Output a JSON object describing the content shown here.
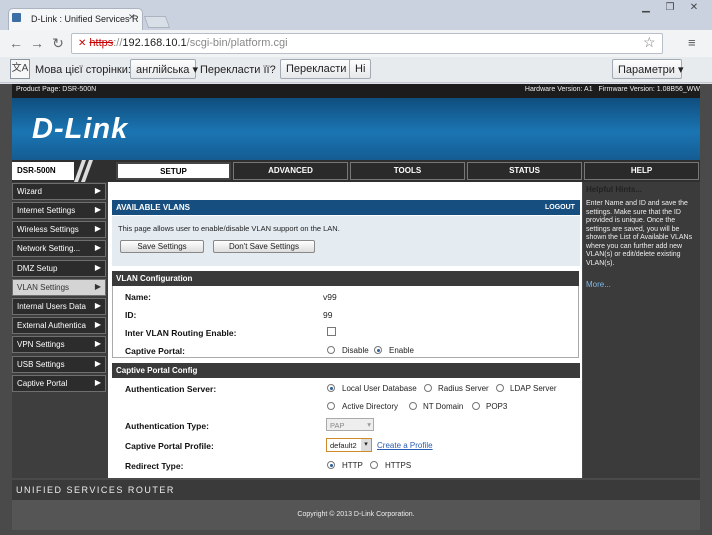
{
  "browser": {
    "tab_title": "D-Link : Unified Services R",
    "url_scheme": "https",
    "url_sep": "://",
    "url_host": "192.168.10.1",
    "url_path": "/scgi-bin/platform.cgi"
  },
  "translate_bar": {
    "prompt": "Мова цієї сторінки:",
    "language": "англійська",
    "question": "Перекласти її?",
    "translate_button": "Перекласти",
    "no_button": "Ні",
    "options_button": "Параметри"
  },
  "page": {
    "product_page": "Product Page: DSR-500N",
    "hardware_version": "Hardware Version: A1",
    "firmware_version": "Firmware Version: 1.08B56_WW",
    "logo": "D-Link",
    "model": "DSR-500N",
    "nav_tabs": [
      "SETUP",
      "ADVANCED",
      "TOOLS",
      "STATUS",
      "HELP"
    ],
    "sidebar": [
      "Wizard",
      "Internet Settings",
      "Wireless Settings",
      "Network Setting...",
      "DMZ Setup",
      "VLAN Settings",
      "Internal Users Data",
      "External Authentica",
      "VPN Settings",
      "USB Settings",
      "Captive Portal"
    ],
    "available_vlans": {
      "title": "AVAILABLE VLANS",
      "logout": "LOGOUT",
      "description": "This page allows user to enable/disable VLAN support on the LAN.",
      "save_button": "Save Settings",
      "dont_save_button": "Don't Save Settings"
    },
    "vlan_config": {
      "title": "VLAN Configuration",
      "name_label": "Name:",
      "name_value": "v99",
      "id_label": "ID:",
      "id_value": "99",
      "inter_vlan_label": "Inter VLAN Routing Enable:",
      "captive_portal_label": "Captive Portal:",
      "disable": "Disable",
      "enable": "Enable"
    },
    "captive_config": {
      "title": "Captive Portal Config",
      "auth_server_label": "Authentication Server:",
      "servers": [
        "Local User Database",
        "Radius Server",
        "LDAP Server",
        "Active Directory",
        "NT Domain",
        "POP3"
      ],
      "auth_type_label": "Authentication Type:",
      "auth_type_value": "PAP",
      "profile_label": "Captive Portal Profile:",
      "profile_value": "default2",
      "create_profile": "Create a Profile",
      "redirect_label": "Redirect Type:",
      "redirect_http": "HTTP",
      "redirect_https": "HTTPS"
    },
    "help": {
      "title": "Helpful Hints...",
      "text": "Enter Name and ID and save the settings. Make sure that the ID provided is unique. Once the settings are saved, you will be shown the List of Available VLANs where you can further add new VLAN(s) or edit/delete existing VLAN(s).",
      "more": "More..."
    },
    "footer_brand": "UNIFIED SERVICES ROUTER",
    "copyright": "Copyright © 2013 D-Link Corporation."
  }
}
